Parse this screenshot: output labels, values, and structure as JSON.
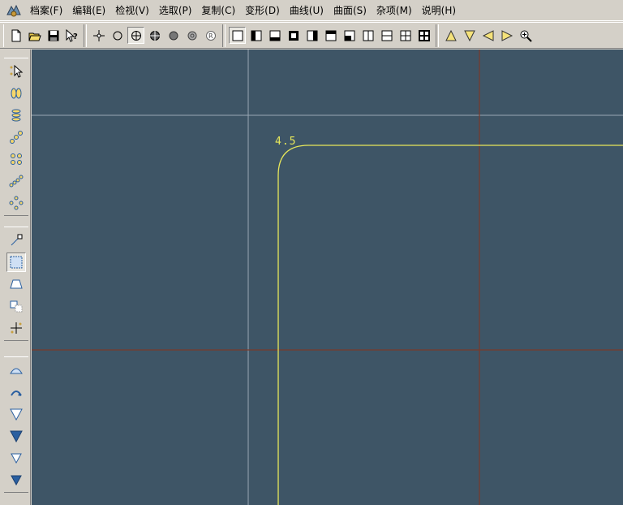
{
  "menu": {
    "items": [
      {
        "label": "档案(F)"
      },
      {
        "label": "编辑(E)"
      },
      {
        "label": "检视(V)"
      },
      {
        "label": "选取(P)"
      },
      {
        "label": "复制(C)"
      },
      {
        "label": "变形(D)"
      },
      {
        "label": "曲线(U)"
      },
      {
        "label": "曲面(S)"
      },
      {
        "label": "杂项(M)"
      },
      {
        "label": "说明(H)"
      }
    ]
  },
  "canvas": {
    "dimension_label": "4.5",
    "background_color": "#3e5566",
    "curve_color": "#e8e85a"
  },
  "icons": {
    "app": "app-icon",
    "file": [
      "new-file-icon",
      "open-file-icon",
      "save-icon",
      "help-pointer-icon"
    ],
    "snap": [
      "snap-point-icon",
      "snap-circle-icon",
      "snap-center-icon",
      "snap-grid-icon",
      "snap-solid-dot-icon",
      "snap-ring-icon",
      "snap-r-icon"
    ],
    "views": [
      "view-single-icon",
      "view-left-icon",
      "view-bottom-icon",
      "view-frame-icon",
      "view-right-icon",
      "view-top-icon",
      "view-corner-icon",
      "view-vsplit-icon",
      "view-hsplit-icon",
      "view-quad-icon",
      "view-quad-bold-icon"
    ],
    "nav": [
      "triangle-up-icon",
      "triangle-down-icon",
      "triangle-left-icon",
      "triangle-right-icon",
      "zoom-icon"
    ]
  }
}
